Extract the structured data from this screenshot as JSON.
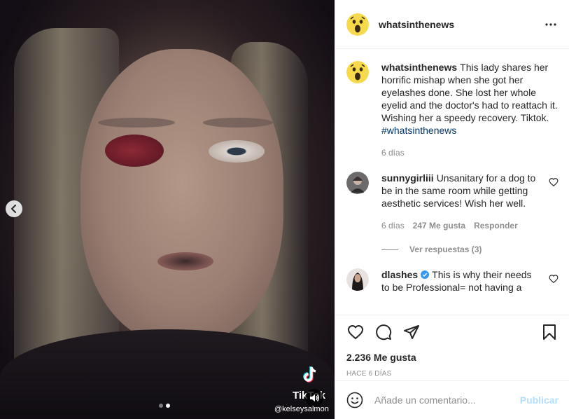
{
  "account": {
    "username": "whatsinthenews"
  },
  "media": {
    "watermark_brand": "TikTok",
    "watermark_user": "@kelseysalmon",
    "slides_total": 2,
    "slide_active": 2
  },
  "caption": {
    "username": "whatsinthenews",
    "text": "This lady shares her horrific mishap when she got her eyelashes done. She lost her whole eyelid and the doctor's had to reattach it. Wishing her a speedy recovery. Tiktok. ",
    "hashtag": "#whatsinthenews",
    "time": "6 días"
  },
  "comments": [
    {
      "username": "sunnygirliii",
      "text": "Unsanitary for a dog to be in the same room while getting aesthetic services! Wish her well.",
      "time": "6 días",
      "likes": "247 Me gusta",
      "reply_label": "Responder",
      "view_replies": "Ver respuestas (3)"
    },
    {
      "username": "dlashes",
      "verified": true,
      "text": "This is why their needs to be Professional= not having a"
    }
  ],
  "stats": {
    "likes": "2.236 Me gusta",
    "posted": "HACE 6 DÍAS"
  },
  "composer": {
    "placeholder": "Añade un comentario...",
    "publish_label": "Publicar"
  },
  "colors": {
    "link": "#00376b",
    "publish_disabled": "#b2dffc",
    "muted": "#8e8e8e",
    "verified": "#3897f0"
  }
}
